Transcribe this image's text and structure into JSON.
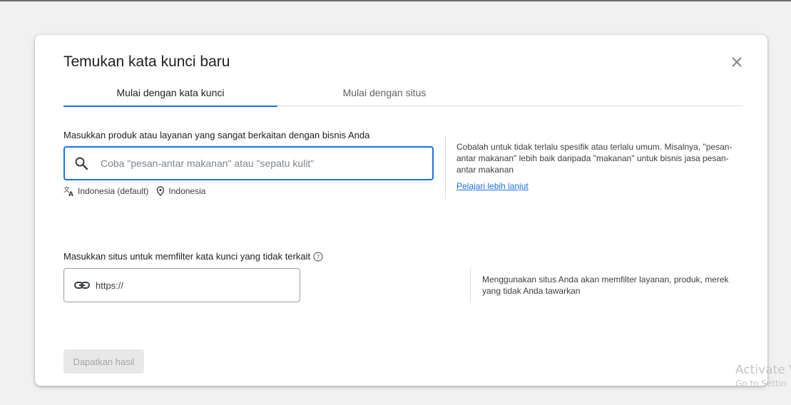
{
  "dialog": {
    "title": "Temukan kata kunci baru",
    "tabs": [
      {
        "label": "Mulai dengan kata kunci",
        "active": true
      },
      {
        "label": "Mulai dengan situs",
        "active": false
      }
    ],
    "keyword_section": {
      "label": "Masukkan produk atau layanan yang sangat berkaitan dengan bisnis Anda",
      "placeholder": "Coba \"pesan-antar makanan\" atau \"sepatu kulit\"",
      "value": "",
      "language": "Indonesia (default)",
      "location": "Indonesia",
      "help_text": "Cobalah untuk tidak terlalu spesifik atau terlalu umum. Misalnya, \"pesan-antar makanan\" lebih baik daripada \"makanan\" untuk bisnis jasa pesan-antar makanan",
      "learn_more": "Pelajari lebih lanjut"
    },
    "site_section": {
      "label": "Masukkan situs untuk memfilter kata kunci yang tidak terkait",
      "value": "https://",
      "help_text": "Menggunakan situs Anda akan memfilter layanan, produk, merek yang tidak Anda tawarkan"
    },
    "submit_label": "Dapatkan hasil",
    "submit_disabled": true
  },
  "icons": {
    "close": "close-icon",
    "search": "search-icon",
    "translate": "translate-icon",
    "location": "location-pin-icon",
    "help": "help-circle-icon",
    "link": "link-icon"
  },
  "watermark": {
    "line1": "Activate W",
    "line2": "Go to Settin"
  },
  "colors": {
    "accent": "#1a73e8",
    "background": "#f1f1f1",
    "dialog": "#ffffff",
    "disabled_button": "#e8e8e8"
  }
}
